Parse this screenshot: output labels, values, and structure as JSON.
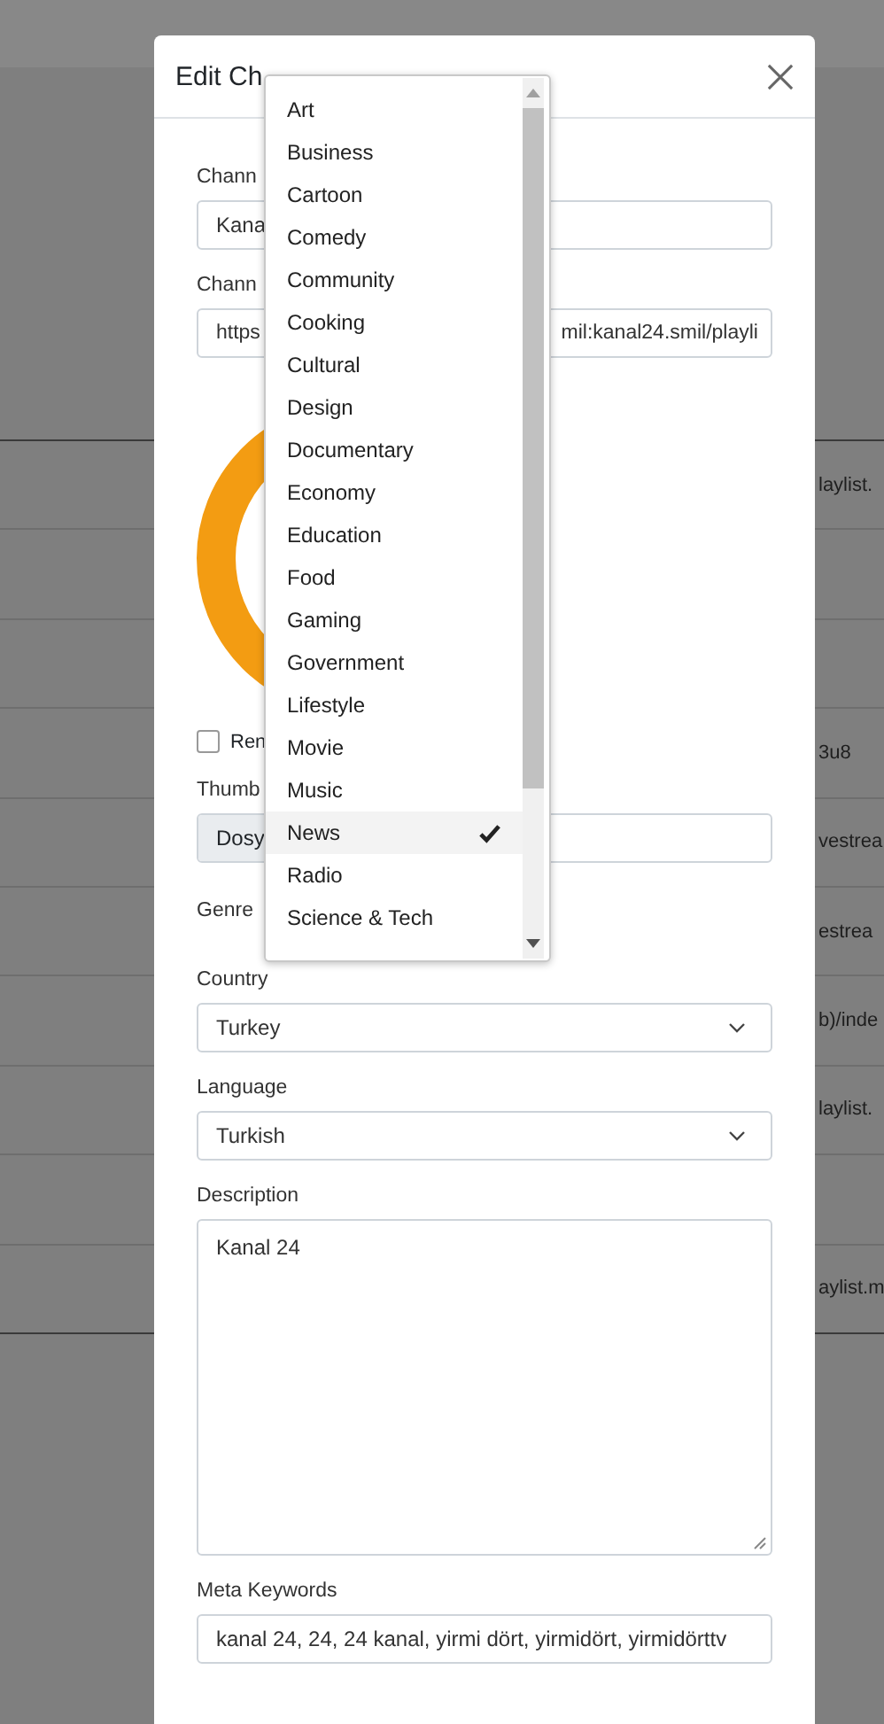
{
  "background_table": {
    "rows": [
      {
        "cell": "laylist."
      },
      {},
      {},
      {
        "cell": "3u8"
      },
      {
        "cell": "vestrea"
      },
      {
        "cell": "estrea"
      },
      {
        "cell": "b)/inde"
      },
      {
        "cell": "laylist."
      },
      {},
      {
        "cell": "aylist.m"
      }
    ]
  },
  "modal": {
    "title": "Edit Ch",
    "name_field": {
      "label": "Chann",
      "value": "Kana"
    },
    "url_field": {
      "label": "Chann",
      "value_start": "https",
      "value_end": "mil:kanal24.smil/playli"
    },
    "remove_checkbox": {
      "label": "Ren",
      "checked": false
    },
    "thumbnail": {
      "label": "Thumb",
      "button": "Dosy"
    },
    "genre": {
      "label": "Genre"
    },
    "country": {
      "label": "Country",
      "value": "Turkey"
    },
    "language": {
      "label": "Language",
      "value": "Turkish"
    },
    "description": {
      "label": "Description",
      "value": "Kanal 24"
    },
    "meta_keywords": {
      "label": "Meta Keywords",
      "value": "kanal 24, 24, 24 kanal, yirmi dört, yirmidört, yirmidörttv"
    }
  },
  "genre_dropdown": {
    "options": [
      {
        "label": "Art",
        "selected": false
      },
      {
        "label": "Business",
        "selected": false
      },
      {
        "label": "Cartoon",
        "selected": false
      },
      {
        "label": "Comedy",
        "selected": false
      },
      {
        "label": "Community",
        "selected": false
      },
      {
        "label": "Cooking",
        "selected": false
      },
      {
        "label": "Cultural",
        "selected": false
      },
      {
        "label": "Design",
        "selected": false
      },
      {
        "label": "Documentary",
        "selected": false
      },
      {
        "label": "Economy",
        "selected": false
      },
      {
        "label": "Education",
        "selected": false
      },
      {
        "label": "Food",
        "selected": false
      },
      {
        "label": "Gaming",
        "selected": false
      },
      {
        "label": "Government",
        "selected": false
      },
      {
        "label": "Lifestyle",
        "selected": false
      },
      {
        "label": "Movie",
        "selected": false
      },
      {
        "label": "Music",
        "selected": false
      },
      {
        "label": "News",
        "selected": true
      },
      {
        "label": "Radio",
        "selected": false
      },
      {
        "label": "Science & Tech",
        "selected": false
      }
    ]
  }
}
